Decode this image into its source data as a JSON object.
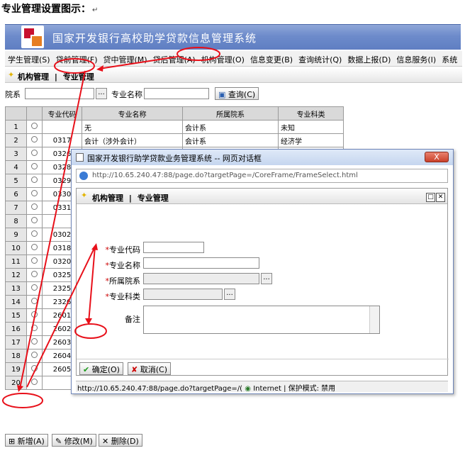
{
  "doc": {
    "heading": "专业管理设置图示：",
    "para_mark": "↵"
  },
  "app": {
    "system_title": "国家开发银行高校助学贷款信息管理系统"
  },
  "menu": [
    "学生管理(S)",
    "贷前管理(F)",
    "贷中管理(M)",
    "贷后管理(A)",
    "机构管理(O)",
    "信息变更(B)",
    "查询统计(Q)",
    "数据上报(D)",
    "信息服务(I)",
    "系统"
  ],
  "breadcrumb": {
    "section": "机构管理",
    "sep": "|",
    "page": "专业管理"
  },
  "search": {
    "dept_label": "院系",
    "major_label": "专业名称",
    "dots": "...",
    "query_button": "查询(C)"
  },
  "table": {
    "headers": [
      "",
      "",
      "专业代码",
      "专业名称",
      "所属院系",
      "专业科类"
    ],
    "rows": [
      [
        "1",
        "",
        "无",
        "会计系",
        "未知"
      ],
      [
        "2",
        "0317",
        "会计（涉外会计）",
        "会计系",
        "经济学"
      ],
      [
        "3",
        "0326",
        "",
        "",
        ""
      ],
      [
        "4",
        "0328",
        "",
        "",
        ""
      ],
      [
        "5",
        "0329",
        "",
        "",
        ""
      ],
      [
        "6",
        "0330",
        "",
        "",
        ""
      ],
      [
        "7",
        "0331",
        "",
        "",
        ""
      ],
      [
        "8",
        "",
        "",
        "",
        ""
      ],
      [
        "9",
        "0302",
        "",
        "",
        ""
      ],
      [
        "10",
        "0318",
        "",
        "",
        ""
      ],
      [
        "11",
        "0320",
        "",
        "",
        ""
      ],
      [
        "12",
        "0325",
        "",
        "",
        ""
      ],
      [
        "13",
        "2325",
        "",
        "",
        ""
      ],
      [
        "14",
        "2326",
        "",
        "",
        ""
      ],
      [
        "15",
        "2601",
        "",
        "",
        ""
      ],
      [
        "16",
        "2602",
        "",
        "",
        ""
      ],
      [
        "17",
        "2603",
        "",
        "",
        ""
      ],
      [
        "18",
        "2604",
        "",
        "",
        ""
      ],
      [
        "19",
        "2605",
        "",
        "",
        ""
      ],
      [
        "20",
        "",
        "",
        "",
        ""
      ]
    ]
  },
  "dialog": {
    "title": "国家开发银行助学贷款业务管理系统 -- 网页对话框",
    "close": "X",
    "address": "http://10.65.240.47:88/page.do?targetPage=/CoreFrame/FrameSelect.html",
    "inner_section": "机构管理",
    "inner_sep": "|",
    "inner_page": "专业管理",
    "fields": {
      "code_label": "专业代码",
      "name_label": "专业名称",
      "dept_label": "所属院系",
      "category_label": "专业科类",
      "remark_label": "备注",
      "required_mark": "*"
    },
    "ok_button": "确定(O)",
    "cancel_button": "取消(C)",
    "status_url": "http://10.65.240.47:88/page.do?targetPage=/(",
    "status_zone": "Internet | 保护模式: 禁用"
  },
  "bottom": {
    "add_button": "新增(A)",
    "edit_button": "修改(M)",
    "delete_button": "删除(D)"
  },
  "colors": {
    "annotation_red": "#e8101a",
    "banner_blue": "#6d8bcb"
  }
}
